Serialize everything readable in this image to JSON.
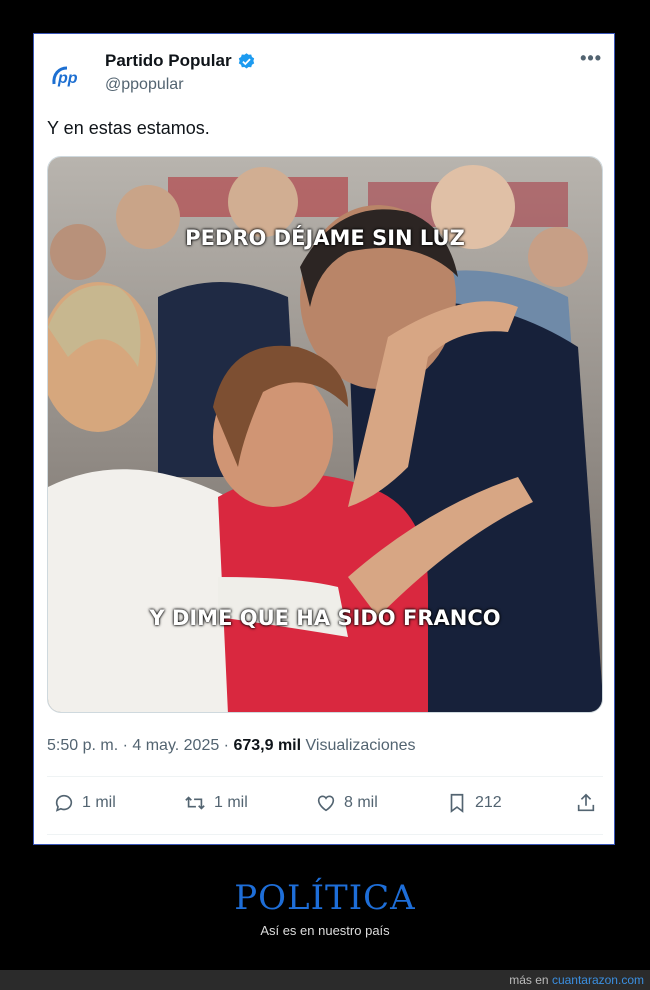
{
  "tweet": {
    "author_name": "Partido Popular",
    "author_handle": "@ppopular",
    "text": "Y en estas estamos.",
    "media": {
      "caption_top": "PEDRO DÉJAME SIN LUZ",
      "caption_bottom": "Y DIME QUE HA SIDO FRANCO"
    },
    "timestamp": "5:50 p. m. · 4 may. 2025 ·",
    "views_count": "673,9 mil",
    "views_label": "Visualizaciones",
    "actions": {
      "replies": "1 mil",
      "reposts": "1 mil",
      "likes": "8 mil",
      "bookmarks": "212"
    }
  },
  "footer": {
    "category": "POLÍTICA",
    "subtitle": "Así es en nuestro país",
    "more_prefix": "más en",
    "site": "cuantarazon.com"
  },
  "colors": {
    "accent": "#1d9bf0",
    "card_border": "#3a56b8",
    "footer_title": "#1e6ed8"
  },
  "icons": [
    "pp-logo-icon",
    "verified-badge-icon",
    "more-icon",
    "reply-icon",
    "repost-icon",
    "like-icon",
    "bookmark-icon",
    "share-icon"
  ]
}
